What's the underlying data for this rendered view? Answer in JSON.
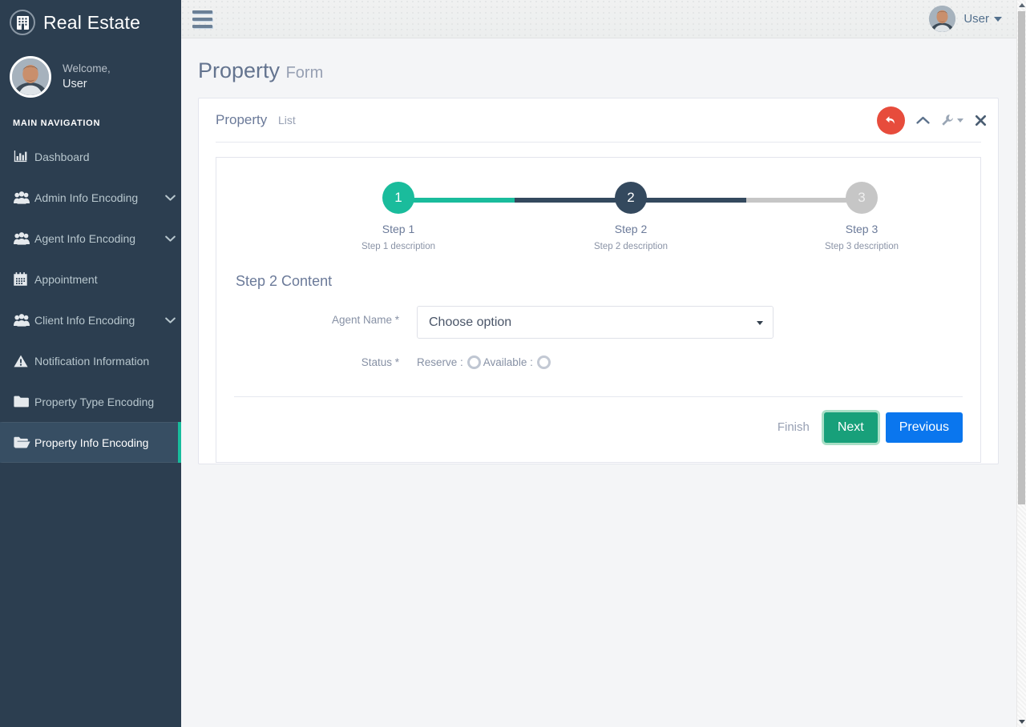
{
  "brand": {
    "name": "Real Estate",
    "logo_icon": "building-icon"
  },
  "sidebar": {
    "user": {
      "welcome_label": "Welcome,",
      "name": "User",
      "avatar_icon": "avatar"
    },
    "nav_title": "MAIN NAVIGATION",
    "items": [
      {
        "label": "Dashboard",
        "icon": "bar-chart-icon",
        "caret": "",
        "active": false
      },
      {
        "label": "Admin Info Encoding",
        "icon": "users-icon",
        "caret": "⌄",
        "active": false
      },
      {
        "label": "Agent Info Encoding",
        "icon": "users-icon",
        "caret": "⌄",
        "active": false
      },
      {
        "label": "Appointment",
        "icon": "calendar-icon",
        "caret": "",
        "active": false
      },
      {
        "label": "Client Info Encoding",
        "icon": "users-icon",
        "caret": "⌄",
        "active": false
      },
      {
        "label": "Notification Information",
        "icon": "warning-icon",
        "caret": "",
        "active": false
      },
      {
        "label": "Property Type Encoding",
        "icon": "folder-icon",
        "caret": "",
        "active": false
      },
      {
        "label": "Property Info Encoding",
        "icon": "folder-open-icon",
        "caret": "",
        "active": true
      }
    ]
  },
  "topbar": {
    "menu_toggle_icon": "hamburger-icon",
    "user_label": "User",
    "user_caret_icon": "caret-down-icon",
    "avatar_icon": "avatar"
  },
  "page": {
    "title": "Property",
    "subtitle": "Form"
  },
  "card": {
    "title": "Property",
    "title_muted": "List",
    "tools": {
      "back_icon": "undo-arrow-icon",
      "collapse_icon": "chevron-up-icon",
      "settings_icon": "wrench-icon",
      "settings_caret_icon": "caret-down-icon",
      "close_icon": "close-x-icon"
    }
  },
  "wizard": {
    "steps": [
      {
        "number": "1",
        "name": "Step 1",
        "description": "Step 1 description",
        "state": "done"
      },
      {
        "number": "2",
        "name": "Step 2",
        "description": "Step 2 description",
        "state": "active"
      },
      {
        "number": "3",
        "name": "Step 3",
        "description": "Step 3 description",
        "state": "todo"
      }
    ],
    "colors": {
      "done": "#1abc9c",
      "active": "#34495e",
      "todo": "#c6c6c6"
    }
  },
  "form": {
    "heading": "Step 2 Content",
    "agent_name": {
      "label": "Agent Name *",
      "value": "Choose option",
      "caret_icon": "caret-down-icon"
    },
    "status": {
      "label": "Status *",
      "options": [
        {
          "label": "Reserve :",
          "selected": false
        },
        {
          "label": "Available :",
          "selected": false
        }
      ]
    }
  },
  "actions": {
    "finish": "Finish",
    "next": "Next",
    "previous": "Previous",
    "next_color": "#18a07a",
    "previous_color": "#0a76ee"
  },
  "scrollbar": {
    "up_icon": "scroll-up-arrow-icon",
    "down_icon": "scroll-down-arrow-icon"
  }
}
